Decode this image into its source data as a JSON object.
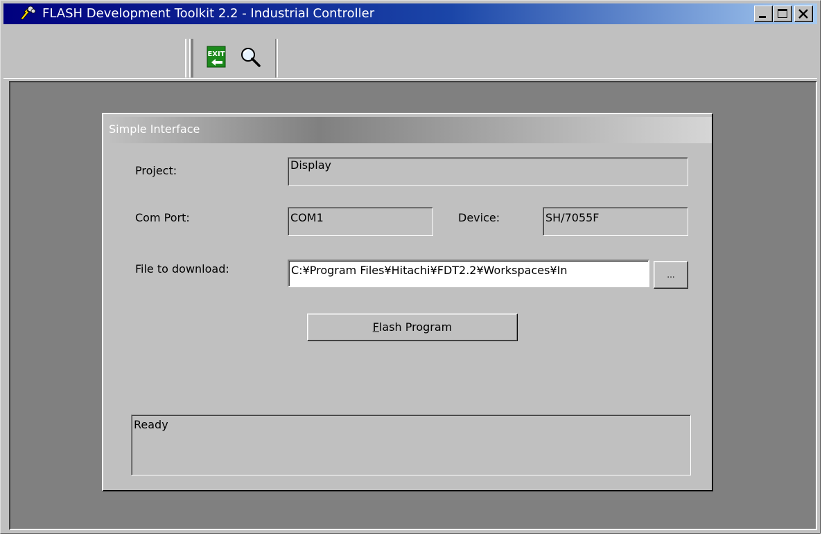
{
  "window": {
    "title": "FLASH Development Toolkit 2.2 - Industrial Controller",
    "icons": {
      "app": "flash-toolkit-icon",
      "minimize": "minimize-icon",
      "maximize": "maximize-icon",
      "close": "close-icon"
    }
  },
  "toolbar": {
    "exit_label": "EXIT",
    "exit_icon": "exit-icon",
    "zoom_icon": "magnifier-icon"
  },
  "panel": {
    "title": "Simple Interface",
    "project_label": "Project:",
    "project_value": "Display",
    "com_port_label": "Com Port:",
    "com_port_value": "COM1",
    "device_label": "Device:",
    "device_value": "SH/7055F",
    "file_label": "File to download:",
    "file_value": "C:¥Program Files¥Hitachi¥FDT2.2¥Workspaces¥In",
    "browse_label": "...",
    "flash_mnemonic": "F",
    "flash_rest": "lash Program",
    "status": "Ready"
  },
  "colors": {
    "titlebar_start": "#00007e",
    "titlebar_end": "#a6caf0",
    "face": "#c0c0c0",
    "workspace": "#808080"
  }
}
